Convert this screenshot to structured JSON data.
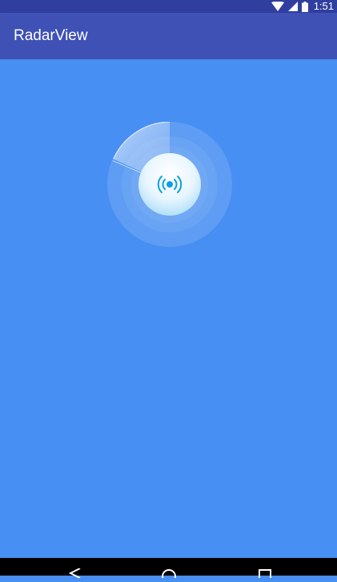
{
  "status_bar": {
    "time": "1:51",
    "icons": [
      "wifi-icon",
      "cell-signal-icon",
      "battery-icon"
    ],
    "background": "#303f9f"
  },
  "app_bar": {
    "title": "RadarView",
    "background": "#3f51b5"
  },
  "content": {
    "background": "#478ff2",
    "radar": {
      "center_icon": "broadcast-icon",
      "accent": "#0aa0e6"
    }
  },
  "nav_bar": {
    "buttons": [
      "back-icon",
      "home-icon",
      "recents-icon"
    ],
    "background": "#000000"
  }
}
